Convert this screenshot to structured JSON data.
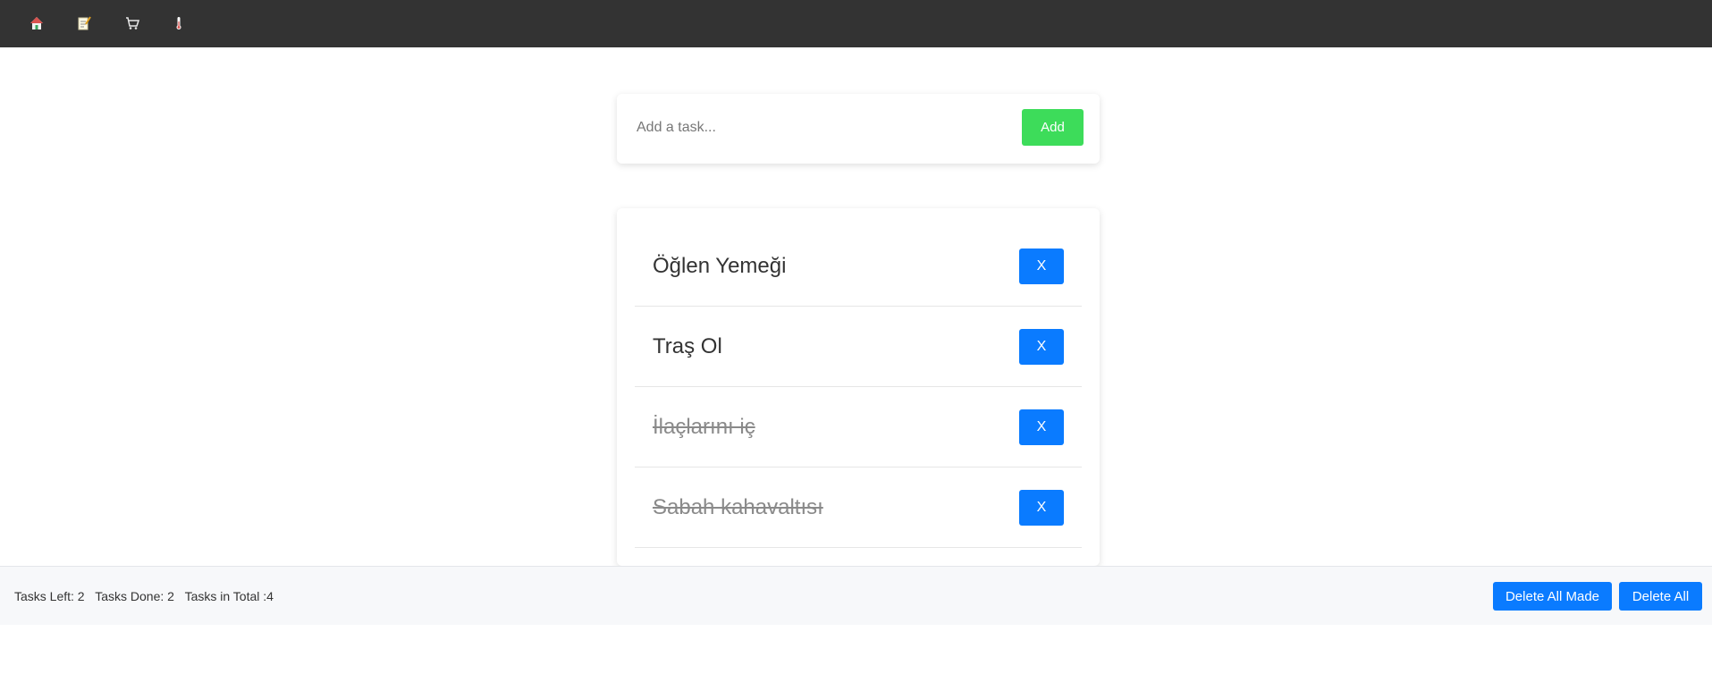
{
  "nav": {
    "items": [
      {
        "icon": "home-icon"
      },
      {
        "icon": "notes-icon"
      },
      {
        "icon": "cart-icon"
      },
      {
        "icon": "thermometer-icon"
      }
    ]
  },
  "input": {
    "placeholder": "Add a task...",
    "value": "",
    "add_label": "Add"
  },
  "tasks": [
    {
      "text": "Öğlen Yemeği",
      "done": false,
      "delete_label": "X"
    },
    {
      "text": "Traş Ol",
      "done": false,
      "delete_label": "X"
    },
    {
      "text": "İlaçlarını iç",
      "done": true,
      "delete_label": "X"
    },
    {
      "text": "Sabah kahavaltısı",
      "done": true,
      "delete_label": "X"
    }
  ],
  "footer": {
    "tasks_left": "Tasks Left: 2",
    "tasks_done": "Tasks Done: 2",
    "tasks_total": "Tasks in Total :4",
    "delete_all_made_label": "Delete All Made",
    "delete_all_label": "Delete All"
  },
  "colors": {
    "nav_bg": "#333333",
    "add_button": "#3ddc5a",
    "primary_button": "#0a7bff",
    "done_text": "#8a8a8a"
  }
}
